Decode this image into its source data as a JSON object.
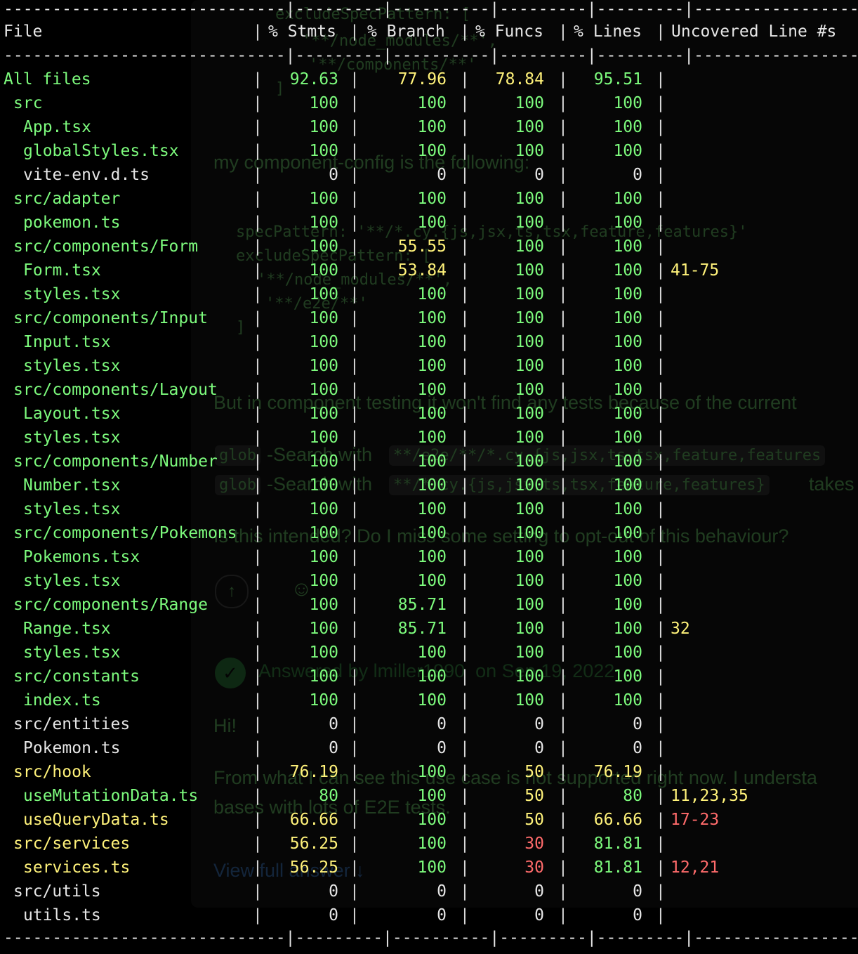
{
  "background_text": {
    "code_top": [
      "excludeSpecPattern: [",
      "'**/node_modules/**',",
      "'**/components/**'",
      "]"
    ],
    "sentence1": "my component-config is the following:",
    "code_mid": [
      "specPattern: '**/*.cy.{js,jsx,ts,tsx,feature,features}'",
      "excludeSpecPattern: [",
      "'**/node_modules/**',",
      "'**/e2e/**'",
      "]"
    ],
    "sentence2": "But in component testing it won't find any tests because of the current",
    "glob_line1": [
      "glob",
      "-Search with",
      "**/e2e/**/*.cy.{js,jsx,ts,tsx,feature,features"
    ],
    "glob_line2": [
      "glob",
      "-Search with",
      "**/*.cy.{js,jsx,ts,tsx,feature,features}",
      "takes"
    ],
    "question": "Is this intended? Do I miss some setting to opt-out of this behaviour?",
    "answered": "Answered by lmiller1990  on Sep 19, 2022",
    "reply_greeting": "Hi!",
    "reply_text": [
      "From what I can see this use case is not supported right now. I understa",
      "bases with lots of E2E tests."
    ],
    "view_full_answer": "View full answer ↓"
  },
  "separator_line": "-----------------------------|---------|----------|---------|---------|-------------------",
  "headers": {
    "file": "File",
    "stmts": "% Stmts",
    "branch": "% Branch",
    "funcs": "% Funcs",
    "lines": "% Lines",
    "uncovered": "Uncovered Line #s"
  },
  "pipe": "|",
  "rows": [
    {
      "file": "All files",
      "indent": 0,
      "stmts": "92.63",
      "branch": "77.96",
      "funcs": "78.84",
      "lines": "95.51",
      "uncovered": ""
    },
    {
      "file": "src",
      "indent": 1,
      "stmts": "100",
      "branch": "100",
      "funcs": "100",
      "lines": "100",
      "uncovered": ""
    },
    {
      "file": "App.tsx",
      "indent": 2,
      "stmts": "100",
      "branch": "100",
      "funcs": "100",
      "lines": "100",
      "uncovered": ""
    },
    {
      "file": "globalStyles.tsx",
      "indent": 2,
      "stmts": "100",
      "branch": "100",
      "funcs": "100",
      "lines": "100",
      "uncovered": ""
    },
    {
      "file": "vite-env.d.ts",
      "indent": 2,
      "stmts": "0",
      "branch": "0",
      "funcs": "0",
      "lines": "0",
      "uncovered": ""
    },
    {
      "file": "src/adapter",
      "indent": 1,
      "stmts": "100",
      "branch": "100",
      "funcs": "100",
      "lines": "100",
      "uncovered": ""
    },
    {
      "file": "pokemon.ts",
      "indent": 2,
      "stmts": "100",
      "branch": "100",
      "funcs": "100",
      "lines": "100",
      "uncovered": ""
    },
    {
      "file": "src/components/Form",
      "indent": 1,
      "stmts": "100",
      "branch": "55.55",
      "funcs": "100",
      "lines": "100",
      "uncovered": ""
    },
    {
      "file": "Form.tsx",
      "indent": 2,
      "stmts": "100",
      "branch": "53.84",
      "funcs": "100",
      "lines": "100",
      "uncovered": "41-75"
    },
    {
      "file": "styles.tsx",
      "indent": 2,
      "stmts": "100",
      "branch": "100",
      "funcs": "100",
      "lines": "100",
      "uncovered": ""
    },
    {
      "file": "src/components/Input",
      "indent": 1,
      "stmts": "100",
      "branch": "100",
      "funcs": "100",
      "lines": "100",
      "uncovered": ""
    },
    {
      "file": "Input.tsx",
      "indent": 2,
      "stmts": "100",
      "branch": "100",
      "funcs": "100",
      "lines": "100",
      "uncovered": ""
    },
    {
      "file": "styles.tsx",
      "indent": 2,
      "stmts": "100",
      "branch": "100",
      "funcs": "100",
      "lines": "100",
      "uncovered": ""
    },
    {
      "file": "src/components/Layout",
      "indent": 1,
      "stmts": "100",
      "branch": "100",
      "funcs": "100",
      "lines": "100",
      "uncovered": ""
    },
    {
      "file": "Layout.tsx",
      "indent": 2,
      "stmts": "100",
      "branch": "100",
      "funcs": "100",
      "lines": "100",
      "uncovered": ""
    },
    {
      "file": "styles.tsx",
      "indent": 2,
      "stmts": "100",
      "branch": "100",
      "funcs": "100",
      "lines": "100",
      "uncovered": ""
    },
    {
      "file": "src/components/Number",
      "indent": 1,
      "stmts": "100",
      "branch": "100",
      "funcs": "100",
      "lines": "100",
      "uncovered": ""
    },
    {
      "file": "Number.tsx",
      "indent": 2,
      "stmts": "100",
      "branch": "100",
      "funcs": "100",
      "lines": "100",
      "uncovered": ""
    },
    {
      "file": "styles.tsx",
      "indent": 2,
      "stmts": "100",
      "branch": "100",
      "funcs": "100",
      "lines": "100",
      "uncovered": ""
    },
    {
      "file": "src/components/Pokemons",
      "indent": 1,
      "stmts": "100",
      "branch": "100",
      "funcs": "100",
      "lines": "100",
      "uncovered": ""
    },
    {
      "file": "Pokemons.tsx",
      "indent": 2,
      "stmts": "100",
      "branch": "100",
      "funcs": "100",
      "lines": "100",
      "uncovered": ""
    },
    {
      "file": "styles.tsx",
      "indent": 2,
      "stmts": "100",
      "branch": "100",
      "funcs": "100",
      "lines": "100",
      "uncovered": ""
    },
    {
      "file": "src/components/Range",
      "indent": 1,
      "stmts": "100",
      "branch": "85.71",
      "funcs": "100",
      "lines": "100",
      "uncovered": ""
    },
    {
      "file": "Range.tsx",
      "indent": 2,
      "stmts": "100",
      "branch": "85.71",
      "funcs": "100",
      "lines": "100",
      "uncovered": "32"
    },
    {
      "file": "styles.tsx",
      "indent": 2,
      "stmts": "100",
      "branch": "100",
      "funcs": "100",
      "lines": "100",
      "uncovered": ""
    },
    {
      "file": "src/constants",
      "indent": 1,
      "stmts": "100",
      "branch": "100",
      "funcs": "100",
      "lines": "100",
      "uncovered": ""
    },
    {
      "file": "index.ts",
      "indent": 2,
      "stmts": "100",
      "branch": "100",
      "funcs": "100",
      "lines": "100",
      "uncovered": ""
    },
    {
      "file": "src/entities",
      "indent": 1,
      "stmts": "0",
      "branch": "0",
      "funcs": "0",
      "lines": "0",
      "uncovered": ""
    },
    {
      "file": "Pokemon.ts",
      "indent": 2,
      "stmts": "0",
      "branch": "0",
      "funcs": "0",
      "lines": "0",
      "uncovered": ""
    },
    {
      "file": "src/hook",
      "indent": 1,
      "stmts": "76.19",
      "branch": "100",
      "funcs": "50",
      "lines": "76.19",
      "uncovered": ""
    },
    {
      "file": "useMutationData.ts",
      "indent": 2,
      "stmts": "80",
      "branch": "100",
      "funcs": "50",
      "lines": "80",
      "uncovered": "11,23,35"
    },
    {
      "file": "useQueryData.ts",
      "indent": 2,
      "stmts": "66.66",
      "branch": "100",
      "funcs": "50",
      "lines": "66.66",
      "uncovered": "17-23"
    },
    {
      "file": "src/services",
      "indent": 1,
      "stmts": "56.25",
      "branch": "100",
      "funcs": "30",
      "lines": "81.81",
      "uncovered": ""
    },
    {
      "file": "services.ts",
      "indent": 2,
      "stmts": "56.25",
      "branch": "100",
      "funcs": "30",
      "lines": "81.81",
      "uncovered": "12,21"
    },
    {
      "file": "src/utils",
      "indent": 1,
      "stmts": "0",
      "branch": "0",
      "funcs": "0",
      "lines": "0",
      "uncovered": ""
    },
    {
      "file": "utils.ts",
      "indent": 2,
      "stmts": "0",
      "branch": "0",
      "funcs": "0",
      "lines": "0",
      "uncovered": ""
    }
  ],
  "colors": {
    "background": "#000000",
    "high": "#7dfb7d",
    "medium": "#fff27a",
    "low": "#ff6b6b",
    "neutral": "#e6e6e6"
  }
}
